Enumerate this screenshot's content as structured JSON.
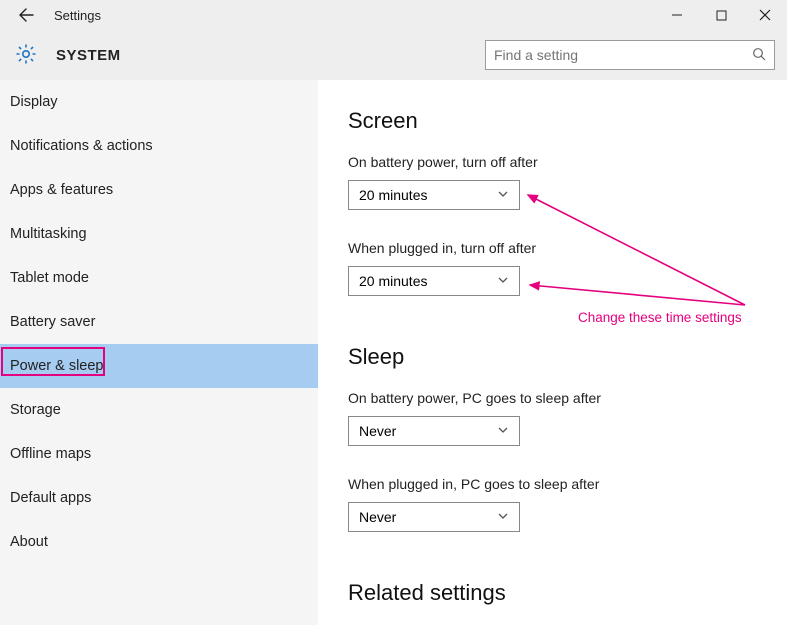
{
  "titlebar": {
    "title": "Settings"
  },
  "header": {
    "system_label": "SYSTEM",
    "search_placeholder": "Find a setting"
  },
  "sidebar": {
    "items": [
      {
        "label": "Display"
      },
      {
        "label": "Notifications & actions"
      },
      {
        "label": "Apps & features"
      },
      {
        "label": "Multitasking"
      },
      {
        "label": "Tablet mode"
      },
      {
        "label": "Battery saver"
      },
      {
        "label": "Power & sleep"
      },
      {
        "label": "Storage"
      },
      {
        "label": "Offline maps"
      },
      {
        "label": "Default apps"
      },
      {
        "label": "About"
      }
    ]
  },
  "content": {
    "screen": {
      "heading": "Screen",
      "battery_label": "On battery power, turn off after",
      "battery_value": "20 minutes",
      "plugged_label": "When plugged in, turn off after",
      "plugged_value": "20 minutes"
    },
    "sleep": {
      "heading": "Sleep",
      "battery_label": "On battery power, PC goes to sleep after",
      "battery_value": "Never",
      "plugged_label": "When plugged in, PC goes to sleep after",
      "plugged_value": "Never"
    },
    "related_heading": "Related settings"
  },
  "annotation": {
    "text": "Change these time settings"
  }
}
